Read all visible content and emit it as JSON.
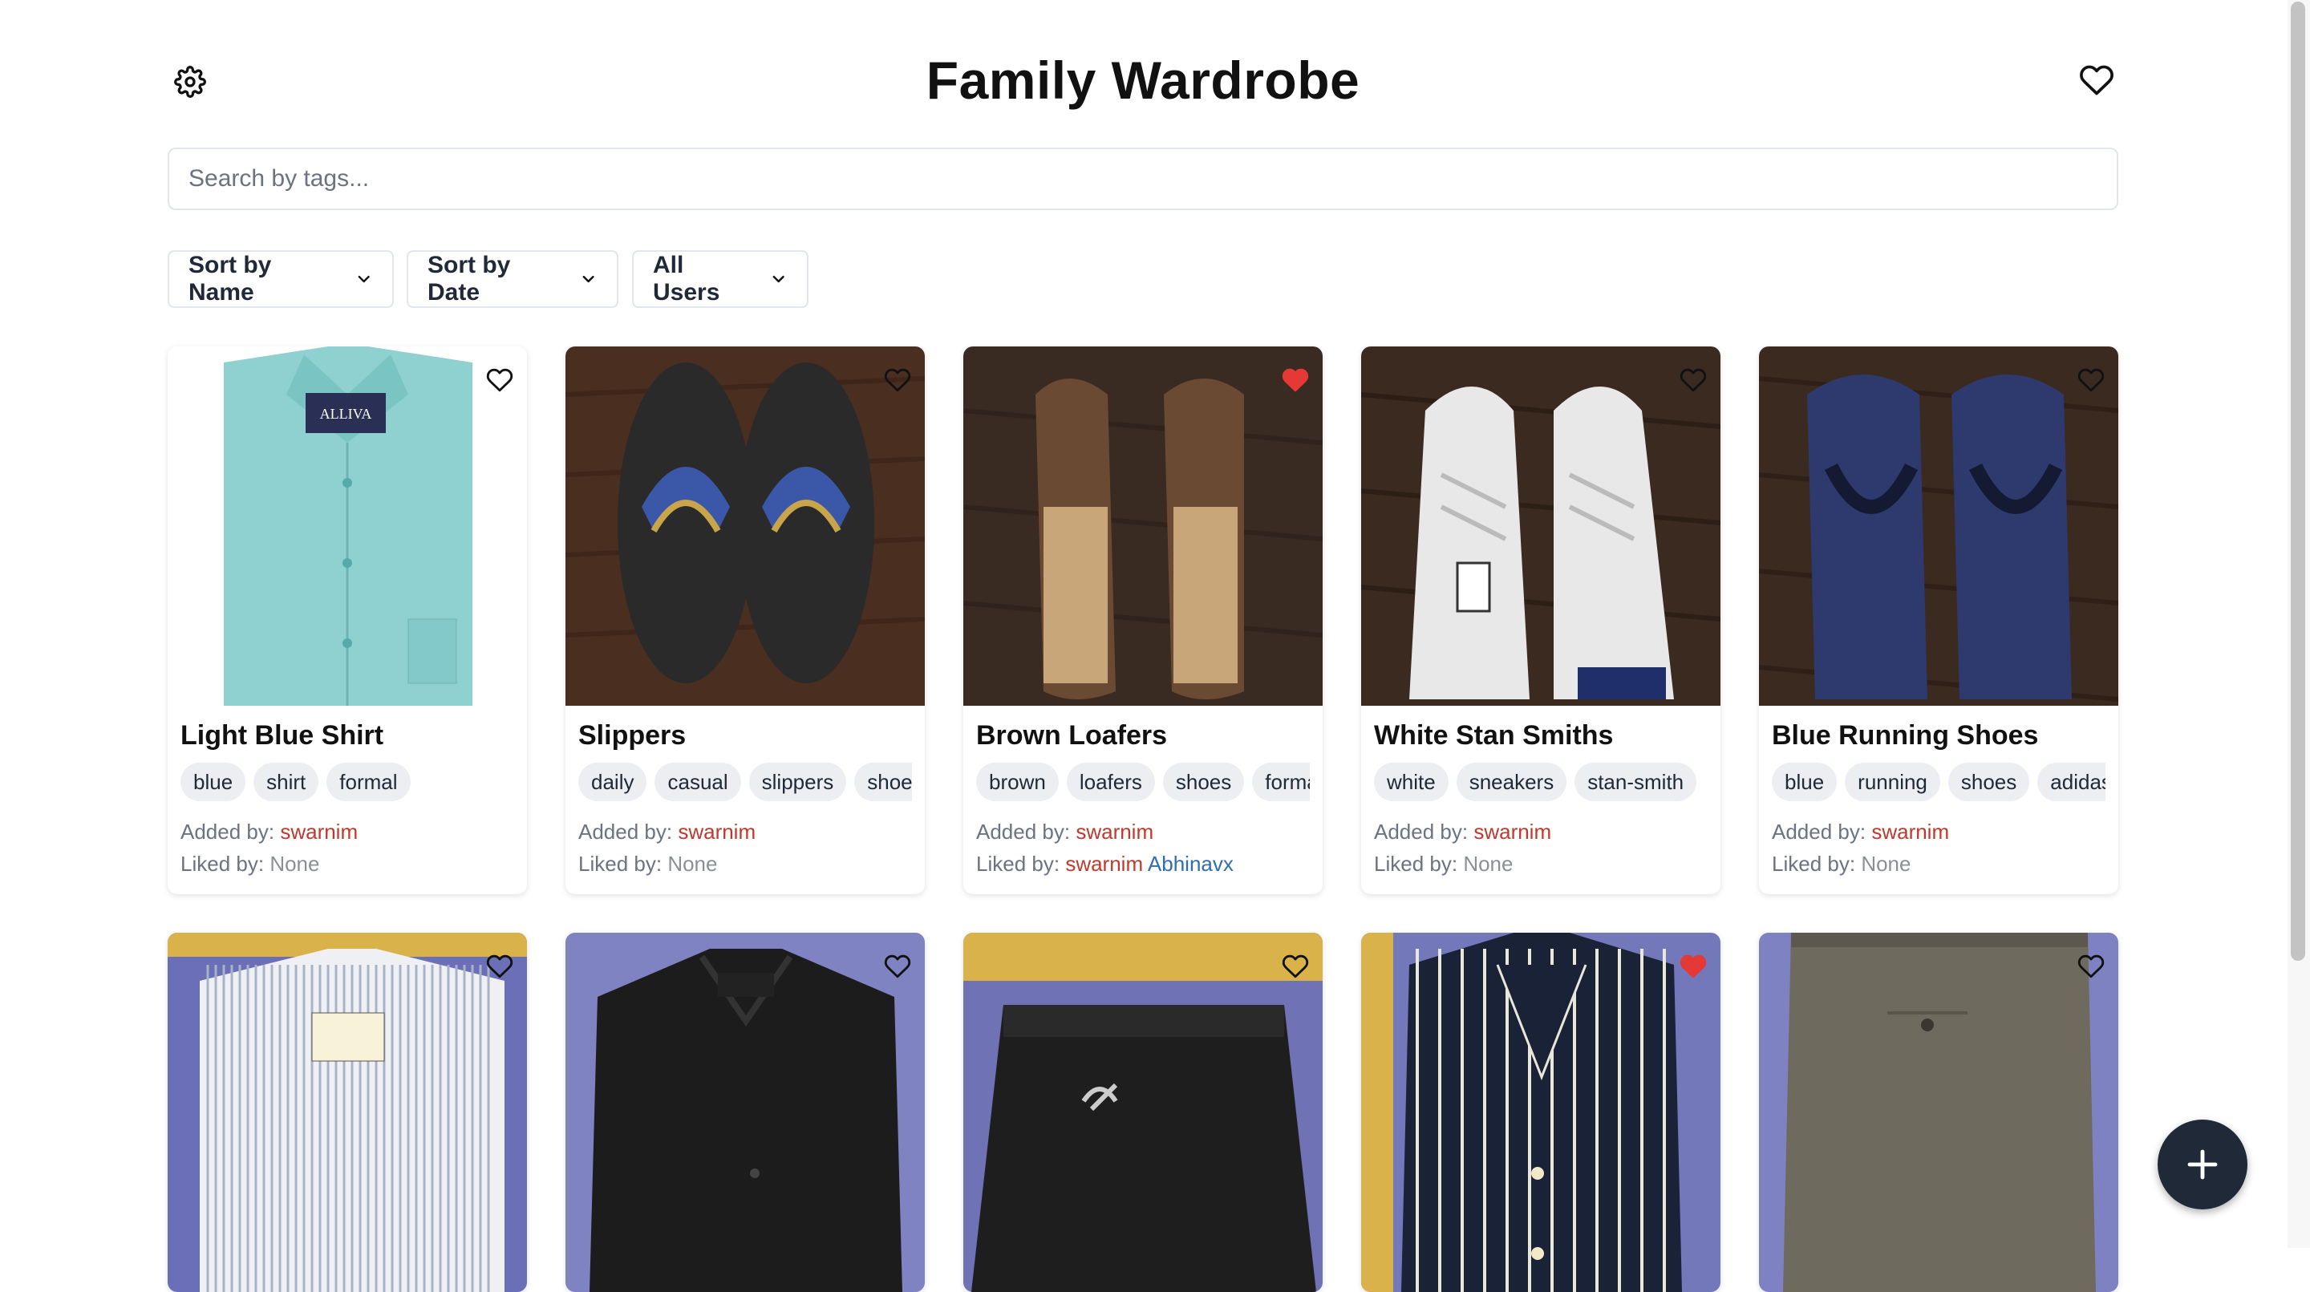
{
  "header": {
    "title": "Family Wardrobe",
    "settings_icon": "gear-icon",
    "favorites_icon": "heart-outline-icon"
  },
  "search": {
    "placeholder": "Search by tags...",
    "value": ""
  },
  "filters": {
    "sort_name": "Sort by Name",
    "sort_date": "Sort by Date",
    "users": "All Users"
  },
  "labels": {
    "added_by": "Added by:",
    "liked_by": "Liked by:",
    "none": "None"
  },
  "items": [
    {
      "name": "Light Blue Shirt",
      "tags": [
        "blue",
        "shirt",
        "formal"
      ],
      "added_by": "swarnim",
      "liked_by": [],
      "liked": false
    },
    {
      "name": "Slippers",
      "tags": [
        "daily",
        "casual",
        "slippers",
        "shoes"
      ],
      "added_by": "swarnim",
      "liked_by": [],
      "liked": false
    },
    {
      "name": "Brown Loafers",
      "tags": [
        "brown",
        "loafers",
        "shoes",
        "formal"
      ],
      "added_by": "swarnim",
      "liked_by": [
        "swarnim",
        "Abhinavx"
      ],
      "liked": true
    },
    {
      "name": "White Stan Smiths",
      "tags": [
        "white",
        "sneakers",
        "stan-smith"
      ],
      "added_by": "swarnim",
      "liked_by": [],
      "liked": false
    },
    {
      "name": "Blue Running Shoes",
      "tags": [
        "blue",
        "running",
        "shoes",
        "adidas"
      ],
      "added_by": "swarnim",
      "liked_by": [],
      "liked": false
    },
    {
      "name": "",
      "tags": [],
      "added_by": "",
      "liked_by": [],
      "liked": false
    },
    {
      "name": "",
      "tags": [],
      "added_by": "",
      "liked_by": [],
      "liked": false
    },
    {
      "name": "",
      "tags": [],
      "added_by": "",
      "liked_by": [],
      "liked": false
    },
    {
      "name": "",
      "tags": [],
      "added_by": "",
      "liked_by": [],
      "liked": true
    },
    {
      "name": "",
      "tags": [],
      "added_by": "",
      "liked_by": [],
      "liked": false
    }
  ],
  "fab": {
    "icon": "plus-icon"
  },
  "colors": {
    "accent_red": "#c0392b",
    "link_blue": "#2e6db4",
    "fab_bg": "#1f2937",
    "liked_heart": "#e53935"
  }
}
